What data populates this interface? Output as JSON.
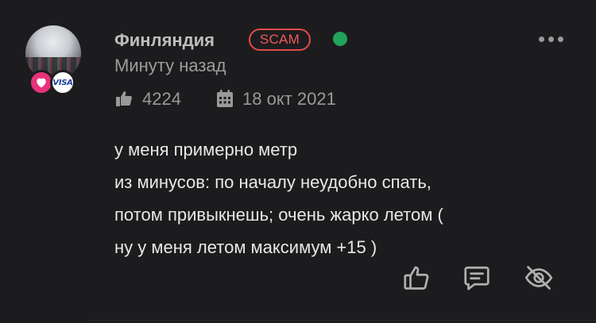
{
  "comment": {
    "author": "Финляндия",
    "tag": "SCAM",
    "timestamp": "Минуту назад",
    "likes": "4224",
    "date": "18 окт 2021",
    "lines": [
      "у меня примерно метр",
      "из минусов: по началу неудобно спать,",
      "потом привыкнешь; очень жарко летом (",
      "ну у меня летом максимум +15 )"
    ],
    "badges": {
      "visa_text": "VISA"
    }
  },
  "colors": {
    "background": "#1c1c1e",
    "online": "#22a35a",
    "scam": "#e14a4a",
    "heart_badge": "#e8327a"
  },
  "icons": [
    "more-dots-icon",
    "thumbs-up-icon",
    "calendar-icon",
    "comment-icon",
    "hide-eye-icon",
    "heart-icon"
  ]
}
